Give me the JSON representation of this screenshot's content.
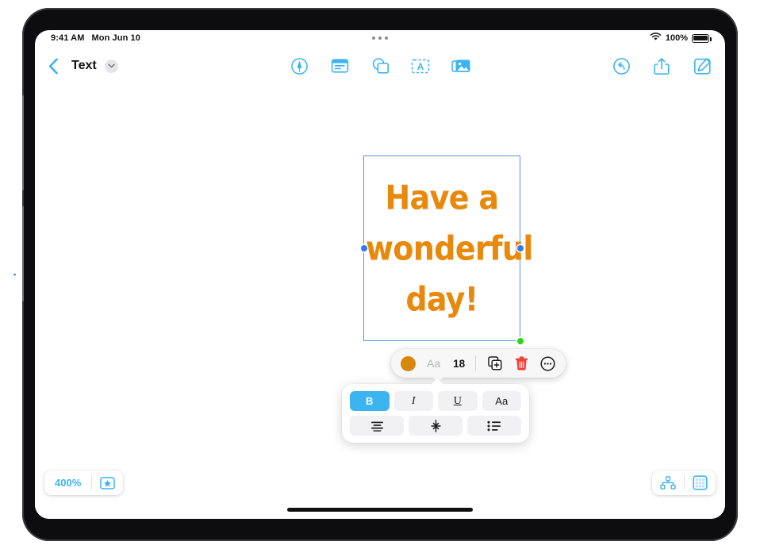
{
  "status_bar": {
    "time": "9:41 AM",
    "date": "Mon Jun 10",
    "battery_percent": "100%",
    "wifi_icon": "wifi-icon",
    "battery_icon": "battery-icon",
    "multitask_handle_icon": "multitasking-dots-icon"
  },
  "app_toolbar": {
    "back_icon": "back-chevron-icon",
    "title": "Text",
    "title_chevron_icon": "chevron-down-icon",
    "center_tools": [
      {
        "name": "draw-tool",
        "icon": "pen-circle-icon"
      },
      {
        "name": "note-tool",
        "icon": "text-note-icon"
      },
      {
        "name": "shapes-tool",
        "icon": "shapes-icon"
      },
      {
        "name": "text-tool",
        "icon": "text-box-a-icon"
      },
      {
        "name": "media-tool",
        "icon": "photos-icon"
      }
    ],
    "right_tools": [
      {
        "name": "undo-button",
        "icon": "undo-icon"
      },
      {
        "name": "share-button",
        "icon": "share-icon"
      },
      {
        "name": "compose-button",
        "icon": "compose-icon"
      }
    ]
  },
  "canvas": {
    "text_object": {
      "lines": [
        "Have a",
        "wonderful",
        "day!"
      ],
      "text": "Have a wonderful day!",
      "color": "#E8890C",
      "selection_border_color": "#5C93E8",
      "handles": [
        {
          "name": "resize-handle-left",
          "color": "#2F7CF0"
        },
        {
          "name": "resize-handle-right",
          "color": "#2F7CF0"
        },
        {
          "name": "resize-handle-bottom-right",
          "color": "#2BD617"
        }
      ]
    }
  },
  "context_toolbar": {
    "color_swatch": {
      "name": "color-swatch",
      "color": "#D9860D"
    },
    "font_label": "Aa",
    "font_size": "18",
    "duplicate_icon": "duplicate-icon",
    "delete_icon": "trash-icon",
    "delete_color": "#F2403A",
    "more_icon": "more-circle-icon"
  },
  "format_panel": {
    "row1": [
      {
        "label": "B",
        "name": "bold-button",
        "active": true
      },
      {
        "label": "I",
        "name": "italic-button",
        "active": false
      },
      {
        "label": "U",
        "name": "underline-button",
        "active": false
      },
      {
        "label": "Aa",
        "name": "font-style-button",
        "active": false
      }
    ],
    "row2": [
      {
        "name": "align-button",
        "icon": "align-center-icon"
      },
      {
        "name": "line-spacing-button",
        "icon": "line-spacing-icon"
      },
      {
        "name": "list-button",
        "icon": "bulleted-list-icon"
      }
    ],
    "active_color": "#3CB4F0"
  },
  "bottom_bar": {
    "zoom_level": "400%",
    "favorite_icon": "star-box-icon",
    "hierarchy_icon": "node-graph-icon",
    "page_icon": "grid-page-icon",
    "accent_color": "#3CB4F0"
  }
}
